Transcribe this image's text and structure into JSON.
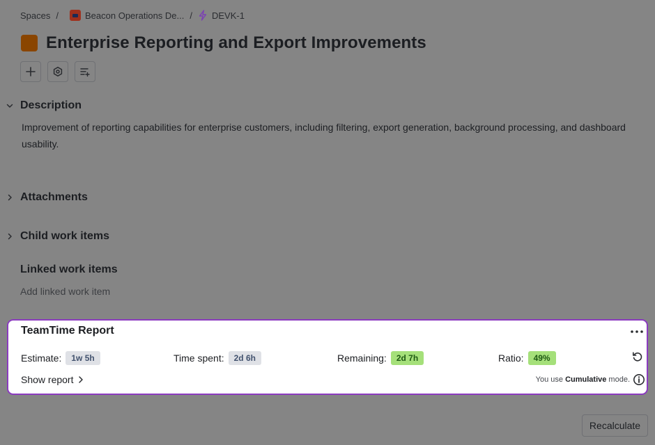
{
  "breadcrumb": {
    "spaces": "Spaces",
    "project": "Beacon Operations De...",
    "issue_key": "DEVK-1",
    "separator": "/"
  },
  "issue": {
    "title": "Enterprise Reporting and Export Improvements"
  },
  "sections": {
    "description": {
      "heading": "Description",
      "text": "Improvement of reporting capabilities for enterprise customers, including filtering, export generation, background processing, and dashboard usability."
    },
    "attachments": {
      "heading": "Attachments"
    },
    "child_items": {
      "heading": "Child work items"
    },
    "linked_items": {
      "heading": "Linked work items",
      "add_label": "Add linked work item"
    }
  },
  "teamtime": {
    "title": "TeamTime Report",
    "estimate": {
      "label": "Estimate:",
      "value": "1w 5h"
    },
    "time_spent": {
      "label": "Time spent:",
      "value": "2d 6h"
    },
    "remaining": {
      "label": "Remaining:",
      "value": "2d 7h"
    },
    "ratio": {
      "label": "Ratio:",
      "value": "49%"
    },
    "show_report": "Show report",
    "mode_prefix": "You use",
    "mode_name": "Cumulative",
    "mode_suffix": "mode."
  },
  "actions": {
    "recalculate": "Recalculate"
  },
  "colors": {
    "panel_border": "#8b3bbf",
    "lozenge_green": "#a5e07a",
    "lozenge_gray": "#dfe1e6",
    "work_type": "#8a4500",
    "overlay": "#858585"
  },
  "icons": {
    "toolbar": [
      "plus-icon",
      "settings-hexagon-icon",
      "list-add-icon"
    ],
    "panel": [
      "more-icon",
      "refresh-icon",
      "info-icon"
    ]
  }
}
